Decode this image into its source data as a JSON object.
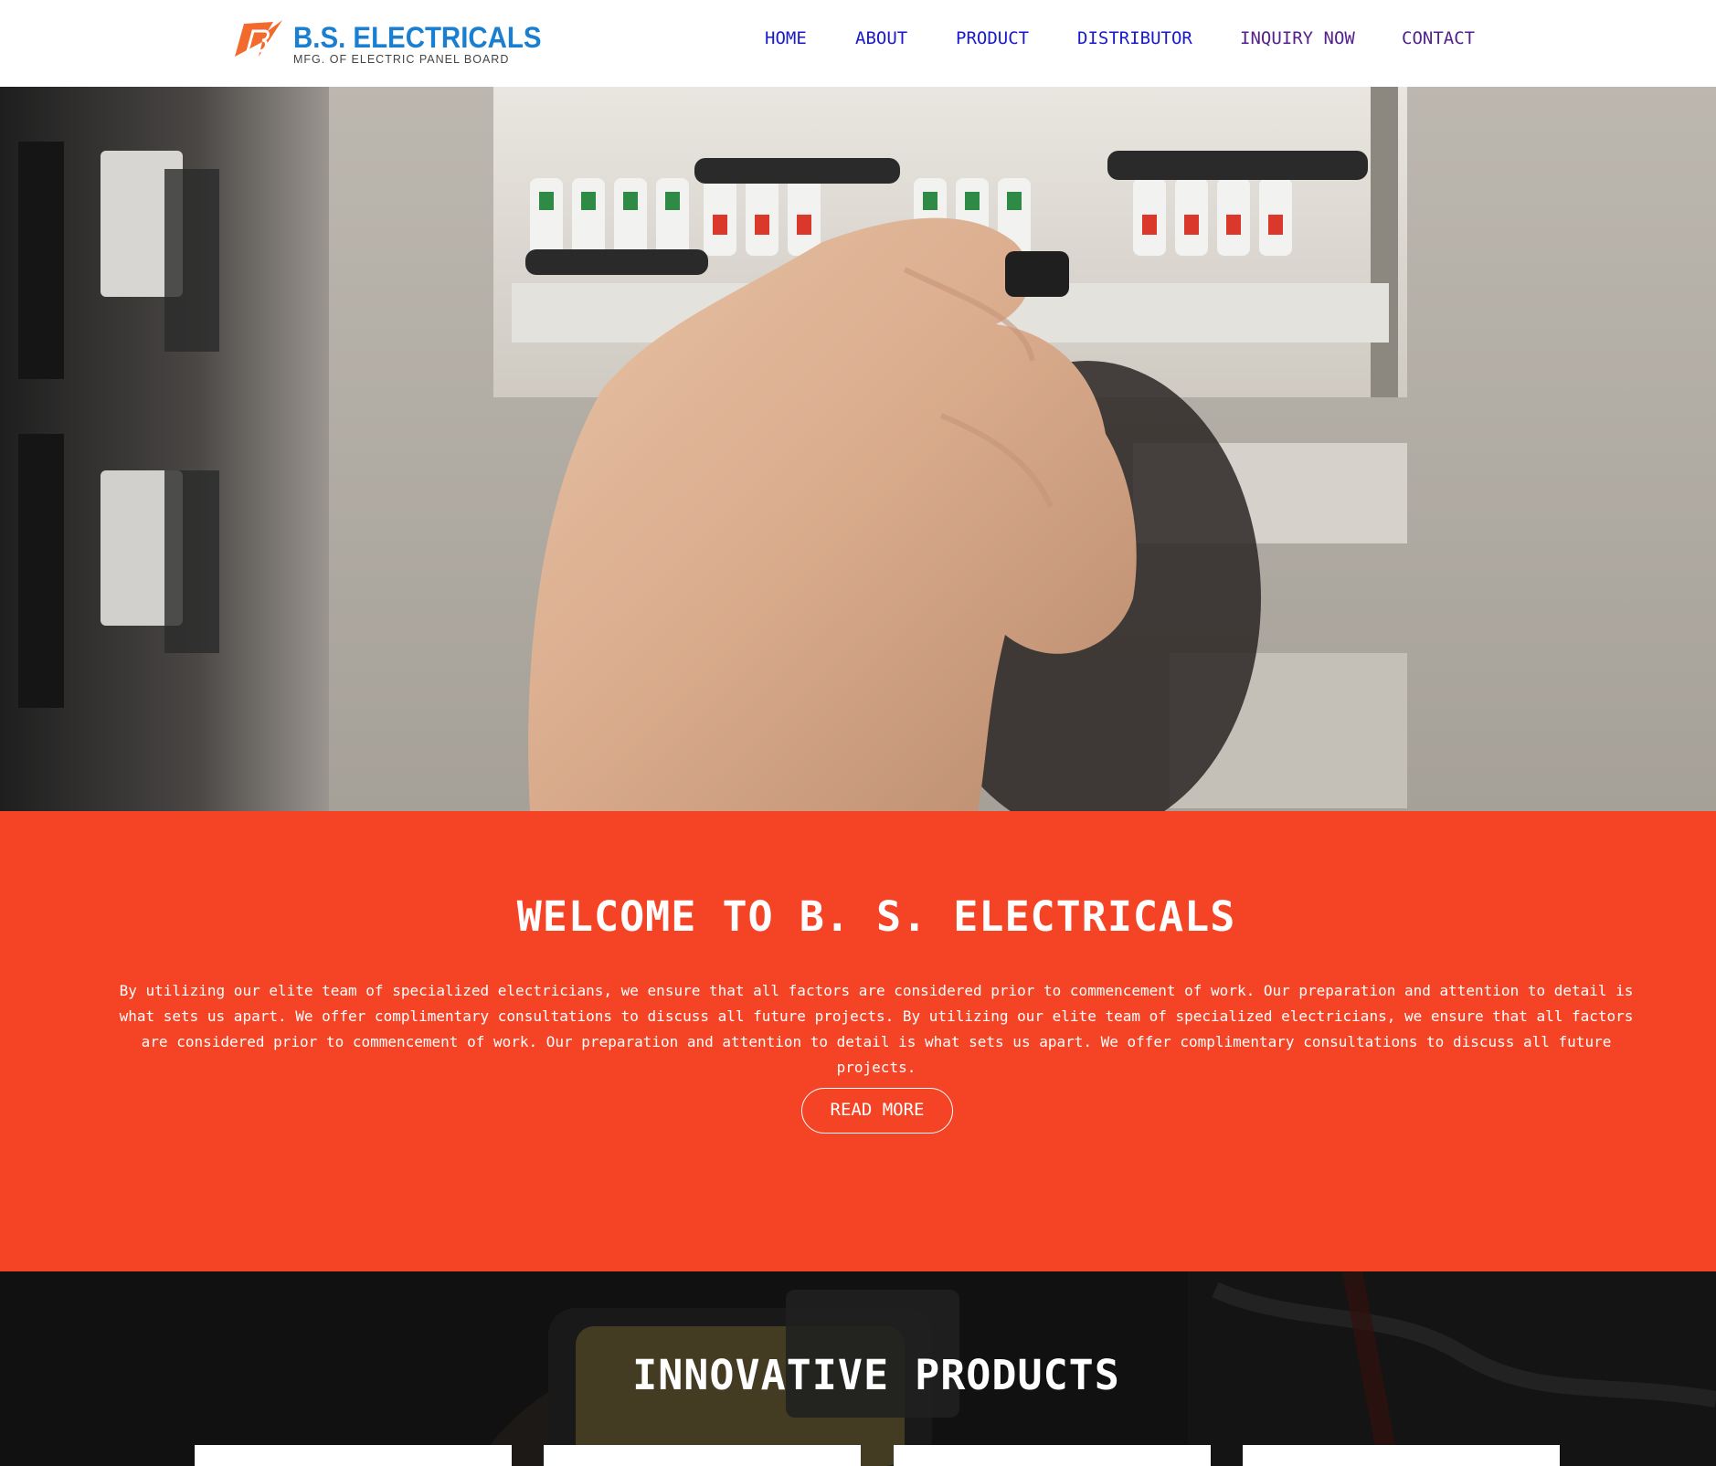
{
  "brand": {
    "name": "B.S. ELECTRICALS",
    "tagline": "MFG. OF ELECTRIC PANEL BOARD",
    "primary_color": "#1a7fd0",
    "accent_color": "#f26a2e"
  },
  "nav": {
    "items": [
      {
        "label": "HOME"
      },
      {
        "label": "ABOUT"
      },
      {
        "label": "PRODUCT"
      },
      {
        "label": "DISTRIBUTOR"
      },
      {
        "label": "INQUIRY NOW"
      },
      {
        "label": "CONTACT"
      }
    ],
    "link_color": "#1a1acc",
    "visited_color": "#55228b"
  },
  "hero": {
    "image": "hand-switching-circuit-breaker-photo"
  },
  "welcome": {
    "title": "WELCOME TO B. S. ELECTRICALS",
    "body": "By utilizing our elite team of specialized electricians, we ensure that all factors are considered prior to commencement of work. Our preparation and attention to detail is what sets us apart. We offer complimentary consultations to discuss all future projects. By utilizing our elite team of specialized electricians, we ensure that all factors are considered prior to commencement of work. Our preparation and attention to detail is what sets us apart. We offer complimentary consultations to discuss all future projects.",
    "button_label": "READ MORE",
    "background_color": "#f54425"
  },
  "products": {
    "title": "INNOVATIVE PRODUCTS",
    "background_image": "multimeter-photo",
    "cards": [
      {
        "name": "product-card-1"
      },
      {
        "name": "product-card-2"
      },
      {
        "name": "product-card-3"
      },
      {
        "name": "product-card-4"
      }
    ]
  }
}
